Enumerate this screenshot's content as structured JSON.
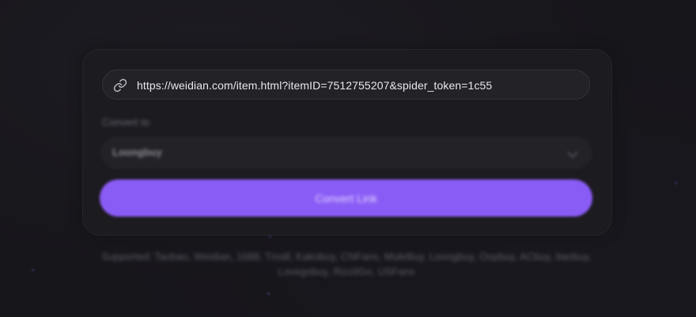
{
  "converter": {
    "url_value": "https://weidian.com/item.html?itemID=7512755207&spider_token=1c55",
    "convert_to_label": "Convert to",
    "selected_agent": "Loongbuy",
    "button_label": "Convert Link",
    "supported_line1": "Supported: Taobao, Weidian, 1688, Tmall, Kakobuy, CNFans, MuleBuy, Loongbuy, Oopbuy, ACbuy, Itaobuy,",
    "supported_line2": "Lovegobuy, RizzitGo, USFans"
  },
  "icons": {
    "url_icon": "link-icon",
    "select_icon": "chevron-down-icon"
  },
  "colors": {
    "background": "#17161b",
    "card": "#1c1b20",
    "field": "#232227",
    "accent": "#8a5cf6",
    "text": "#e9e8ee"
  }
}
